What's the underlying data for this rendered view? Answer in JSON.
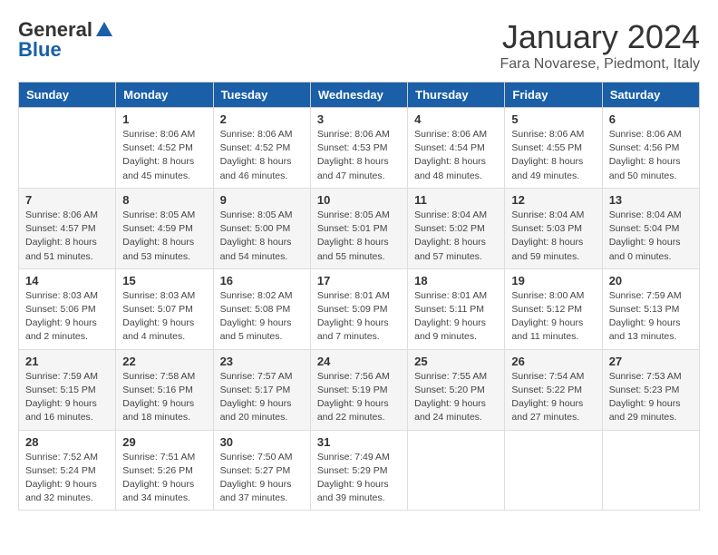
{
  "logo": {
    "general": "General",
    "blue": "Blue"
  },
  "title": {
    "month_year": "January 2024",
    "location": "Fara Novarese, Piedmont, Italy"
  },
  "headers": [
    "Sunday",
    "Monday",
    "Tuesday",
    "Wednesday",
    "Thursday",
    "Friday",
    "Saturday"
  ],
  "weeks": [
    [
      {
        "day": "",
        "info": ""
      },
      {
        "day": "1",
        "info": "Sunrise: 8:06 AM\nSunset: 4:52 PM\nDaylight: 8 hours\nand 45 minutes."
      },
      {
        "day": "2",
        "info": "Sunrise: 8:06 AM\nSunset: 4:52 PM\nDaylight: 8 hours\nand 46 minutes."
      },
      {
        "day": "3",
        "info": "Sunrise: 8:06 AM\nSunset: 4:53 PM\nDaylight: 8 hours\nand 47 minutes."
      },
      {
        "day": "4",
        "info": "Sunrise: 8:06 AM\nSunset: 4:54 PM\nDaylight: 8 hours\nand 48 minutes."
      },
      {
        "day": "5",
        "info": "Sunrise: 8:06 AM\nSunset: 4:55 PM\nDaylight: 8 hours\nand 49 minutes."
      },
      {
        "day": "6",
        "info": "Sunrise: 8:06 AM\nSunset: 4:56 PM\nDaylight: 8 hours\nand 50 minutes."
      }
    ],
    [
      {
        "day": "7",
        "info": "Sunrise: 8:06 AM\nSunset: 4:57 PM\nDaylight: 8 hours\nand 51 minutes."
      },
      {
        "day": "8",
        "info": "Sunrise: 8:05 AM\nSunset: 4:59 PM\nDaylight: 8 hours\nand 53 minutes."
      },
      {
        "day": "9",
        "info": "Sunrise: 8:05 AM\nSunset: 5:00 PM\nDaylight: 8 hours\nand 54 minutes."
      },
      {
        "day": "10",
        "info": "Sunrise: 8:05 AM\nSunset: 5:01 PM\nDaylight: 8 hours\nand 55 minutes."
      },
      {
        "day": "11",
        "info": "Sunrise: 8:04 AM\nSunset: 5:02 PM\nDaylight: 8 hours\nand 57 minutes."
      },
      {
        "day": "12",
        "info": "Sunrise: 8:04 AM\nSunset: 5:03 PM\nDaylight: 8 hours\nand 59 minutes."
      },
      {
        "day": "13",
        "info": "Sunrise: 8:04 AM\nSunset: 5:04 PM\nDaylight: 9 hours\nand 0 minutes."
      }
    ],
    [
      {
        "day": "14",
        "info": "Sunrise: 8:03 AM\nSunset: 5:06 PM\nDaylight: 9 hours\nand 2 minutes."
      },
      {
        "day": "15",
        "info": "Sunrise: 8:03 AM\nSunset: 5:07 PM\nDaylight: 9 hours\nand 4 minutes."
      },
      {
        "day": "16",
        "info": "Sunrise: 8:02 AM\nSunset: 5:08 PM\nDaylight: 9 hours\nand 5 minutes."
      },
      {
        "day": "17",
        "info": "Sunrise: 8:01 AM\nSunset: 5:09 PM\nDaylight: 9 hours\nand 7 minutes."
      },
      {
        "day": "18",
        "info": "Sunrise: 8:01 AM\nSunset: 5:11 PM\nDaylight: 9 hours\nand 9 minutes."
      },
      {
        "day": "19",
        "info": "Sunrise: 8:00 AM\nSunset: 5:12 PM\nDaylight: 9 hours\nand 11 minutes."
      },
      {
        "day": "20",
        "info": "Sunrise: 7:59 AM\nSunset: 5:13 PM\nDaylight: 9 hours\nand 13 minutes."
      }
    ],
    [
      {
        "day": "21",
        "info": "Sunrise: 7:59 AM\nSunset: 5:15 PM\nDaylight: 9 hours\nand 16 minutes."
      },
      {
        "day": "22",
        "info": "Sunrise: 7:58 AM\nSunset: 5:16 PM\nDaylight: 9 hours\nand 18 minutes."
      },
      {
        "day": "23",
        "info": "Sunrise: 7:57 AM\nSunset: 5:17 PM\nDaylight: 9 hours\nand 20 minutes."
      },
      {
        "day": "24",
        "info": "Sunrise: 7:56 AM\nSunset: 5:19 PM\nDaylight: 9 hours\nand 22 minutes."
      },
      {
        "day": "25",
        "info": "Sunrise: 7:55 AM\nSunset: 5:20 PM\nDaylight: 9 hours\nand 24 minutes."
      },
      {
        "day": "26",
        "info": "Sunrise: 7:54 AM\nSunset: 5:22 PM\nDaylight: 9 hours\nand 27 minutes."
      },
      {
        "day": "27",
        "info": "Sunrise: 7:53 AM\nSunset: 5:23 PM\nDaylight: 9 hours\nand 29 minutes."
      }
    ],
    [
      {
        "day": "28",
        "info": "Sunrise: 7:52 AM\nSunset: 5:24 PM\nDaylight: 9 hours\nand 32 minutes."
      },
      {
        "day": "29",
        "info": "Sunrise: 7:51 AM\nSunset: 5:26 PM\nDaylight: 9 hours\nand 34 minutes."
      },
      {
        "day": "30",
        "info": "Sunrise: 7:50 AM\nSunset: 5:27 PM\nDaylight: 9 hours\nand 37 minutes."
      },
      {
        "day": "31",
        "info": "Sunrise: 7:49 AM\nSunset: 5:29 PM\nDaylight: 9 hours\nand 39 minutes."
      },
      {
        "day": "",
        "info": ""
      },
      {
        "day": "",
        "info": ""
      },
      {
        "day": "",
        "info": ""
      }
    ]
  ]
}
